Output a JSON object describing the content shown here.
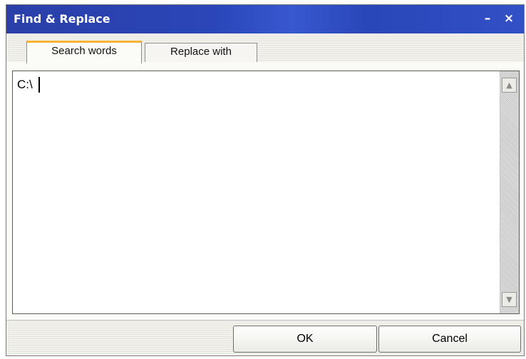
{
  "window": {
    "title": "Find & Replace",
    "minimize_glyph": "–",
    "close_glyph": "×"
  },
  "tabs": [
    {
      "label": "Search words",
      "active": true
    },
    {
      "label": "Replace with",
      "active": false
    }
  ],
  "editor": {
    "value": "C:\\"
  },
  "scrollbar": {
    "up_glyph": "▲",
    "down_glyph": "▼"
  },
  "buttons": {
    "ok_label": "OK",
    "cancel_label": "Cancel"
  },
  "colors": {
    "titlebar": "#2a46b8",
    "active_tab_accent": "#f7b234"
  }
}
